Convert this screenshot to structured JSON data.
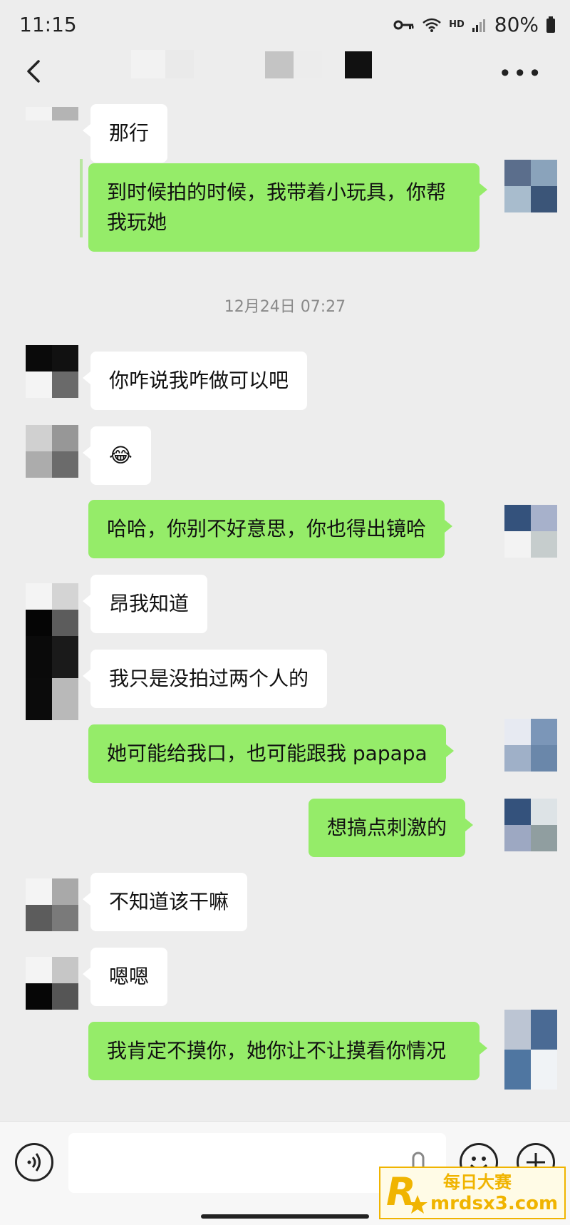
{
  "status_bar": {
    "time": "11:15",
    "hd": "HD",
    "battery": "80%"
  },
  "chat": {
    "timestamp": "12月24日 07:27",
    "messages": [
      {
        "side": "in",
        "text": "那行"
      },
      {
        "side": "out",
        "text": "到时候拍的时候，我带着小玩具，你帮我玩她"
      },
      {
        "side": "in",
        "text": "你咋说我咋做可以吧"
      },
      {
        "side": "in",
        "text": "😂"
      },
      {
        "side": "out",
        "text": "哈哈，你别不好意思，你也得出镜哈"
      },
      {
        "side": "in",
        "text": "昂我知道"
      },
      {
        "side": "in",
        "text": "我只是没拍过两个人的"
      },
      {
        "side": "out",
        "text": "她可能给我口，也可能跟我 papapa"
      },
      {
        "side": "out",
        "text": "想搞点刺激的"
      },
      {
        "side": "in",
        "text": "不知道该干嘛"
      },
      {
        "side": "in",
        "text": "嗯嗯"
      },
      {
        "side": "out",
        "text": "我肯定不摸你，她你让不让摸看你情况"
      }
    ]
  },
  "watermark": {
    "title": "每日大赛",
    "url": "mrdsx3.com"
  },
  "colors": {
    "background": "#ededed",
    "bubble_out": "#95ec69",
    "bubble_in": "#ffffff"
  }
}
